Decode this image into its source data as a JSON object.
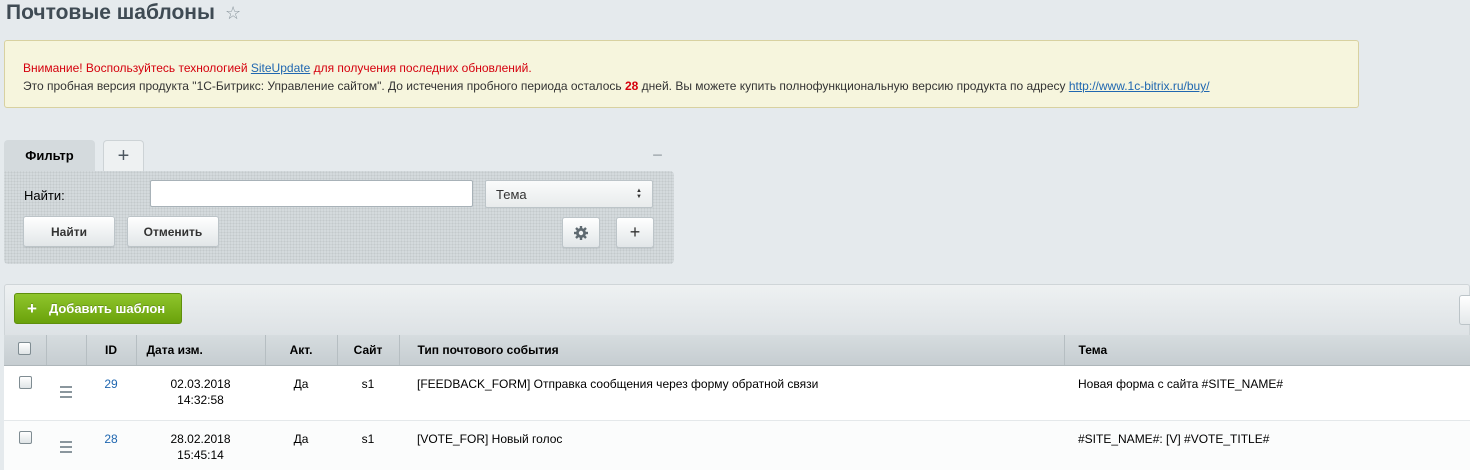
{
  "page": {
    "title": "Почтовые шаблоны",
    "favorite_icon": "star-icon"
  },
  "notice": {
    "warning_prefix": "Внимание! Воспользуйтесь технологией ",
    "warning_link": "SiteUpdate",
    "warning_suffix": " для получения последних обновлений.",
    "info_prefix": "Это пробная версия продукта \"1С-Битрикс: Управление сайтом\". До истечения пробного периода осталось ",
    "days": "28",
    "info_middle": " дней. Вы можете купить полнофункциональную версию продукта по адресу ",
    "buy_link": "http://www.1c-bitrix.ru/buy/"
  },
  "filter": {
    "tab_label": "Фильтр",
    "add_tab_icon": "plus-icon",
    "collapse_icon": "minus-icon",
    "find_label": "Найти:",
    "find_value": "",
    "field_select": "Тема",
    "find_button": "Найти",
    "cancel_button": "Отменить",
    "settings_icon": "gear-icon",
    "add_field_icon": "plus-icon"
  },
  "list": {
    "add_button": "Добавить шаблон",
    "columns": {
      "id": "ID",
      "date": "Дата изм.",
      "active": "Акт.",
      "site": "Сайт",
      "event_type": "Тип почтового события",
      "theme": "Тема"
    },
    "rows": [
      {
        "id": "29",
        "date": "02.03.2018",
        "time": "14:32:58",
        "active": "Да",
        "site": "s1",
        "event_type": "[FEEDBACK_FORM] Отправка сообщения через форму обратной связи",
        "theme": "Новая форма с сайта #SITE_NAME#"
      },
      {
        "id": "28",
        "date": "28.02.2018",
        "time": "15:45:14",
        "active": "Да",
        "site": "s1",
        "event_type": "[VOTE_FOR] Новый голос",
        "theme": "#SITE_NAME#: [V] #VOTE_TITLE#"
      }
    ]
  },
  "colors": {
    "notice_bg": "#f6f5dd",
    "warning_text": "#d5000d",
    "link": "#2067b0",
    "add_button": "#7ab317"
  }
}
